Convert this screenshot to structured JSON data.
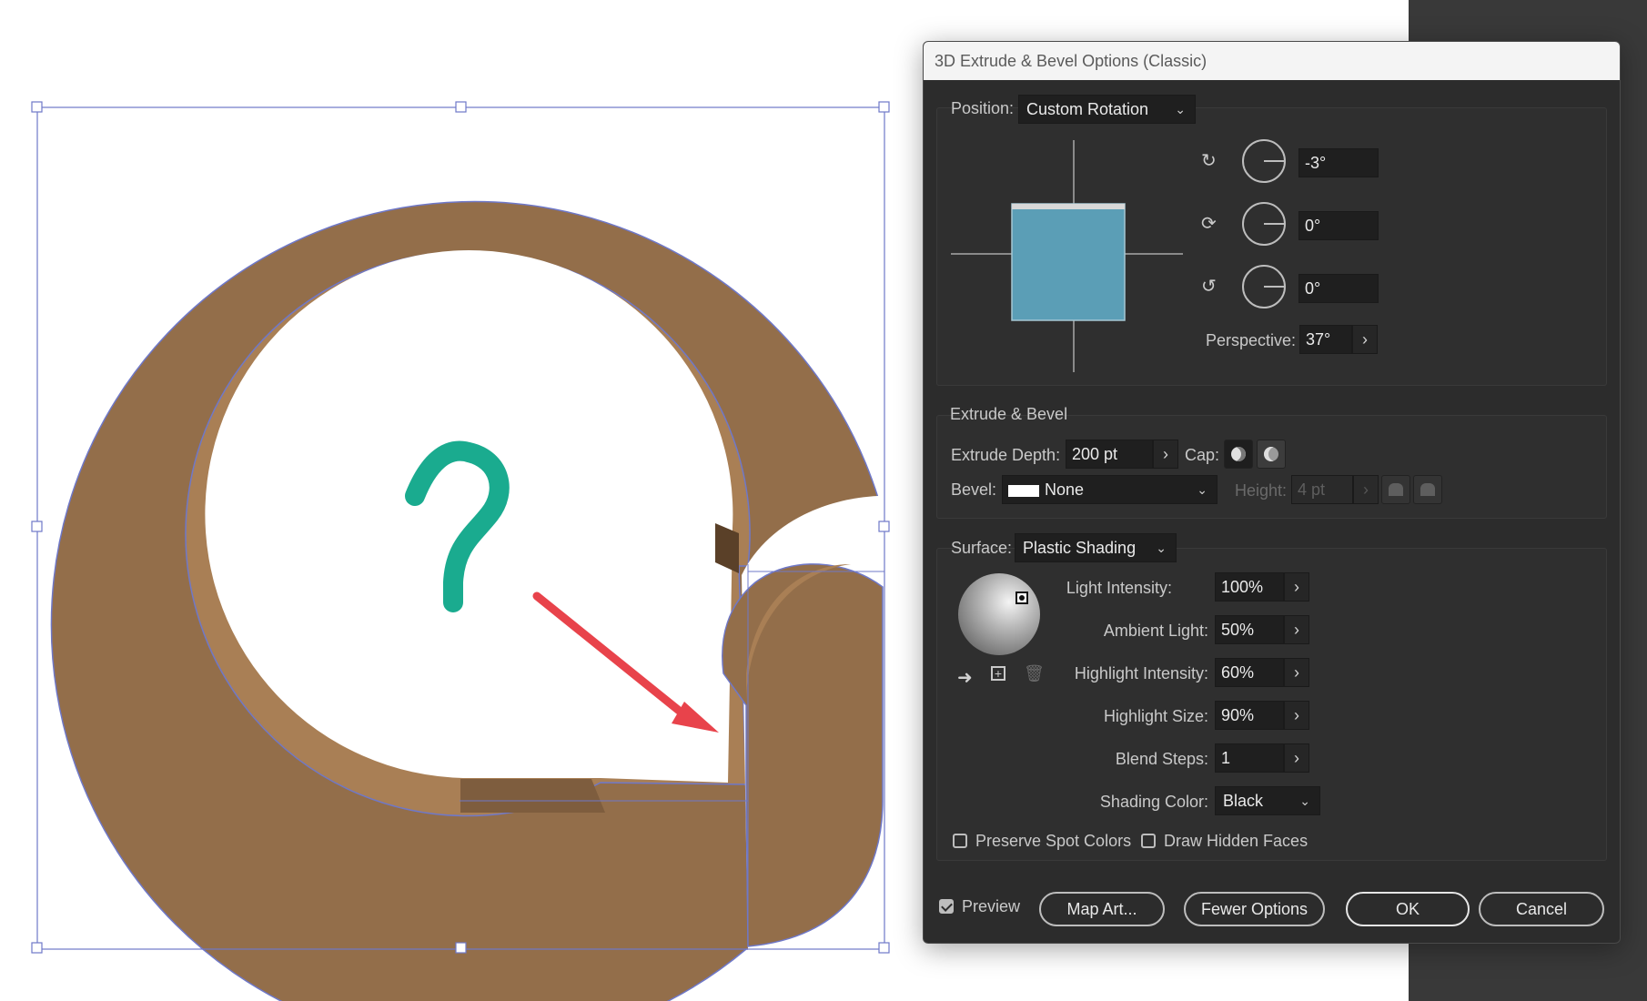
{
  "dialog": {
    "title": "3D Extrude & Bevel Options (Classic)",
    "position": {
      "label": "Position:",
      "value": "Custom Rotation",
      "rotation_x": "-3°",
      "rotation_y": "0°",
      "rotation_z": "0°",
      "perspective_label": "Perspective:",
      "perspective_value": "37°"
    },
    "extrude": {
      "section_label": "Extrude & Bevel",
      "depth_label": "Extrude Depth:",
      "depth_value": "200 pt",
      "cap_label": "Cap:",
      "bevel_label": "Bevel:",
      "bevel_value": "None",
      "height_label": "Height:",
      "height_value": "4 pt"
    },
    "surface": {
      "label": "Surface:",
      "value": "Plastic Shading",
      "light_intensity_label": "Light Intensity:",
      "light_intensity_value": "100%",
      "ambient_light_label": "Ambient Light:",
      "ambient_light_value": "50%",
      "highlight_intensity_label": "Highlight Intensity:",
      "highlight_intensity_value": "60%",
      "highlight_size_label": "Highlight Size:",
      "highlight_size_value": "90%",
      "blend_steps_label": "Blend Steps:",
      "blend_steps_value": "1",
      "shading_color_label": "Shading Color:",
      "shading_color_value": "Black"
    },
    "options": {
      "preserve_spot_colors": "Preserve Spot Colors",
      "draw_hidden_faces": "Draw Hidden Faces",
      "preview": "Preview",
      "preview_checked": true
    },
    "buttons": {
      "map_art": "Map Art...",
      "fewer_options": "Fewer Options",
      "ok": "OK",
      "cancel": "Cancel"
    }
  },
  "canvas": {
    "annotation": "?",
    "colors": {
      "ring_brown": "#936e4a",
      "inner_brown": "#a97f55",
      "dark_brown": "#5a4028",
      "annotation_teal": "#1aab8f",
      "arrow_red": "#e8434b",
      "selection_blue": "#6f78c8",
      "cube_blue": "#5b9eb6"
    }
  }
}
